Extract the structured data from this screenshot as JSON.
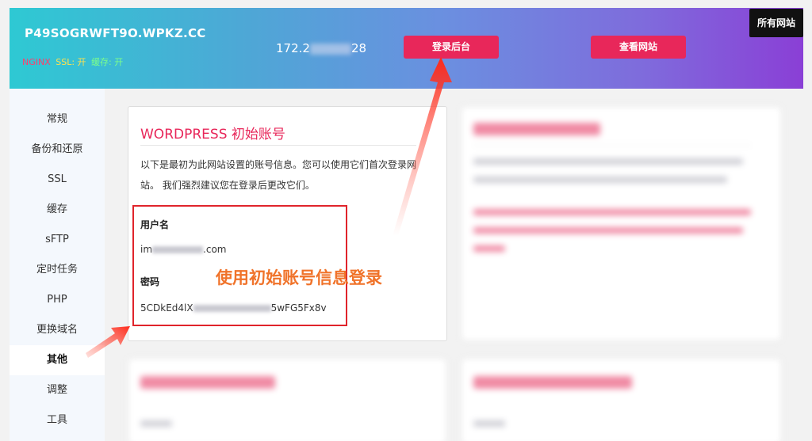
{
  "header": {
    "domain": "P49SOGRWFT9O.WPKZ.CC",
    "tag_nginx": "NGINX",
    "tag_ssl": "SSL: 开",
    "tag_cache": "缓存: 开",
    "ip_prefix": "172.2",
    "ip_suffix": "28",
    "admin_button": "登录后台",
    "view_button": "查看网站",
    "all_sites_button": "所有网站"
  },
  "sidebar": {
    "items": [
      {
        "label": "常规"
      },
      {
        "label": "备份和还原"
      },
      {
        "label": "SSL"
      },
      {
        "label": "缓存"
      },
      {
        "label": "sFTP"
      },
      {
        "label": "定时任务"
      },
      {
        "label": "PHP"
      },
      {
        "label": "更换域名"
      },
      {
        "label": "其他"
      },
      {
        "label": "调整"
      },
      {
        "label": "工具"
      }
    ],
    "active": "其他"
  },
  "account_card": {
    "title": "WORDPRESS 初始账号",
    "description": "以下是最初为此网站设置的账号信息。您可以使用它们首次登录网站。 我们强烈建议您在登录后更改它们。",
    "username_label": "用户名",
    "username_prefix": "im",
    "username_suffix": ".com",
    "password_label": "密码",
    "password_prefix": "5CDkEd4lX",
    "password_suffix": "5wFG5Fx8v"
  },
  "annotation": {
    "text": "使用初始账号信息登录"
  },
  "colors": {
    "accent": "#e8275a",
    "annotation": "#f0732a",
    "highlight_box": "#e0242b"
  }
}
